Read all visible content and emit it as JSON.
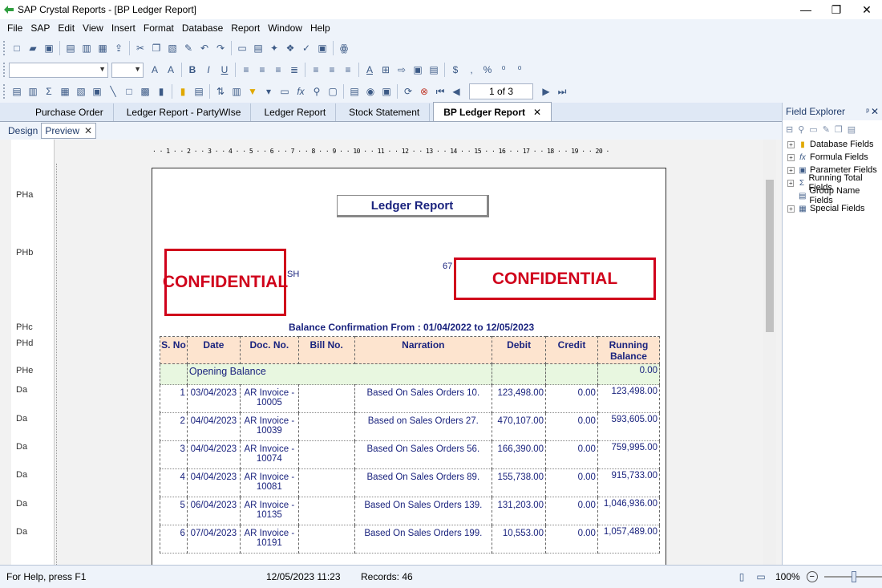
{
  "window": {
    "title": "SAP Crystal Reports - [BP Ledger Report]",
    "minimize": "—",
    "restore": "❐",
    "close": "✕"
  },
  "menu": [
    "File",
    "SAP",
    "Edit",
    "View",
    "Insert",
    "Format",
    "Database",
    "Report",
    "Window",
    "Help"
  ],
  "navigation": {
    "page_indicator": "1 of 3"
  },
  "doc_tabs": [
    {
      "label": "Purchase Order"
    },
    {
      "label": "Ledger Report - PartyWIse"
    },
    {
      "label": "Ledger Report"
    },
    {
      "label": "Stock Statement"
    },
    {
      "label": "BP Ledger Report",
      "active": true
    }
  ],
  "view_tabs": [
    {
      "label": "Design"
    },
    {
      "label": "Preview",
      "active": true
    }
  ],
  "section_labels": [
    "PHa",
    "PHb",
    "PHc",
    "PHd",
    "PHe",
    "Da",
    "Da",
    "Da",
    "Da",
    "Da",
    "Da"
  ],
  "ruler_text": "· · 1 · · 2 · · 3 · · 4 · · 5 · · 6 · · 7 · · 8 · · 9 · · 10 · · 11 · · 12 · · 13 · · 14 · · 15 · · 16 · · 17 · · 18 · · 19 · · 20 ·",
  "report": {
    "title": "Ledger Report",
    "fragment_sh": "SH",
    "fragment_67": "67",
    "confidential": "CONFIDENTIAL",
    "balance_confirmation": "Balance Confirmation From : 01/04/2022  to  12/05/2023",
    "columns": [
      "S. No",
      "Date",
      "Doc. No.",
      "Bill No.",
      "Narration",
      "Debit",
      "Credit",
      "Running Balance"
    ],
    "opening": {
      "label": "Opening Balance",
      "balance": "0.00"
    },
    "rows": [
      {
        "sno": "1",
        "date": "03/04/2023",
        "doc": "AR Invoice - 10005",
        "bill": "",
        "narration": "Based On Sales Orders 10.",
        "debit": "123,498.00",
        "credit": "0.00",
        "balance": "123,498.00"
      },
      {
        "sno": "2",
        "date": "04/04/2023",
        "doc": "AR Invoice - 10039",
        "bill": "",
        "narration": "Based on Sales Orders 27.",
        "debit": "470,107.00",
        "credit": "0.00",
        "balance": "593,605.00"
      },
      {
        "sno": "3",
        "date": "04/04/2023",
        "doc": "AR Invoice - 10074",
        "bill": "",
        "narration": "Based On Sales Orders 56.",
        "debit": "166,390.00",
        "credit": "0.00",
        "balance": "759,995.00"
      },
      {
        "sno": "4",
        "date": "04/04/2023",
        "doc": "AR Invoice - 10081",
        "bill": "",
        "narration": "Based On Sales Orders 89.",
        "debit": "155,738.00",
        "credit": "0.00",
        "balance": "915,733.00"
      },
      {
        "sno": "5",
        "date": "06/04/2023",
        "doc": "AR Invoice - 10135",
        "bill": "",
        "narration": "Based On Sales Orders 139.",
        "debit": "131,203.00",
        "credit": "0.00",
        "balance": "1,046,936.00"
      },
      {
        "sno": "6",
        "date": "07/04/2023",
        "doc": "AR Invoice - 10191",
        "bill": "",
        "narration": "Based On Sales Orders 199.",
        "debit": "10,553.00",
        "credit": "0.00",
        "balance": "1,057,489.00"
      }
    ]
  },
  "field_explorer": {
    "title": "Field Explorer",
    "pin": "ᵖ",
    "close": "✕",
    "items": [
      {
        "label": "Database Fields",
        "icon": "database-icon"
      },
      {
        "label": "Formula Fields",
        "icon": "formula-icon"
      },
      {
        "label": "Parameter Fields",
        "icon": "parameter-icon"
      },
      {
        "label": "Running Total Fields",
        "icon": "running-total-icon"
      },
      {
        "label": "Group Name Fields",
        "icon": "group-name-icon"
      },
      {
        "label": "Special Fields",
        "icon": "special-fields-icon"
      }
    ]
  },
  "status": {
    "help": "For Help, press F1",
    "datetime": "12/05/2023  11:23",
    "records": "Records: 46",
    "zoom": "100%"
  }
}
